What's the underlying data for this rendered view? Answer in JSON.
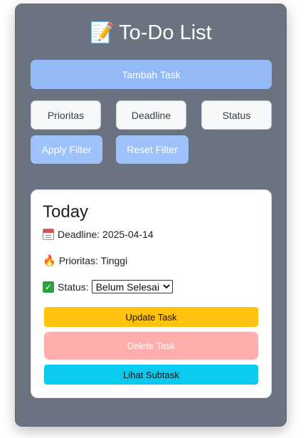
{
  "header": {
    "title": "To-Do List",
    "icon": "memo-icon"
  },
  "actions": {
    "add_task": "Tambah Task"
  },
  "filters": {
    "priority": "Prioritas",
    "deadline": "Deadline",
    "status": "Status",
    "apply": "Apply Filter",
    "reset": "Reset Filter"
  },
  "task": {
    "title": "Today",
    "deadline_text": "Deadline: 2025-04-14",
    "priority_text": "Prioritas: Tinggi",
    "status_label": "Status:",
    "status_value": "Belum Selesai",
    "update_label": "Update Task",
    "delete_label": "Delete Task",
    "subtask_label": "Lihat Subtask"
  },
  "colors": {
    "panel": "#6b7380",
    "primary_light": "#94b9f7",
    "update": "#ffc20e",
    "delete": "#ffadad",
    "subtask": "#0bcaf0"
  }
}
